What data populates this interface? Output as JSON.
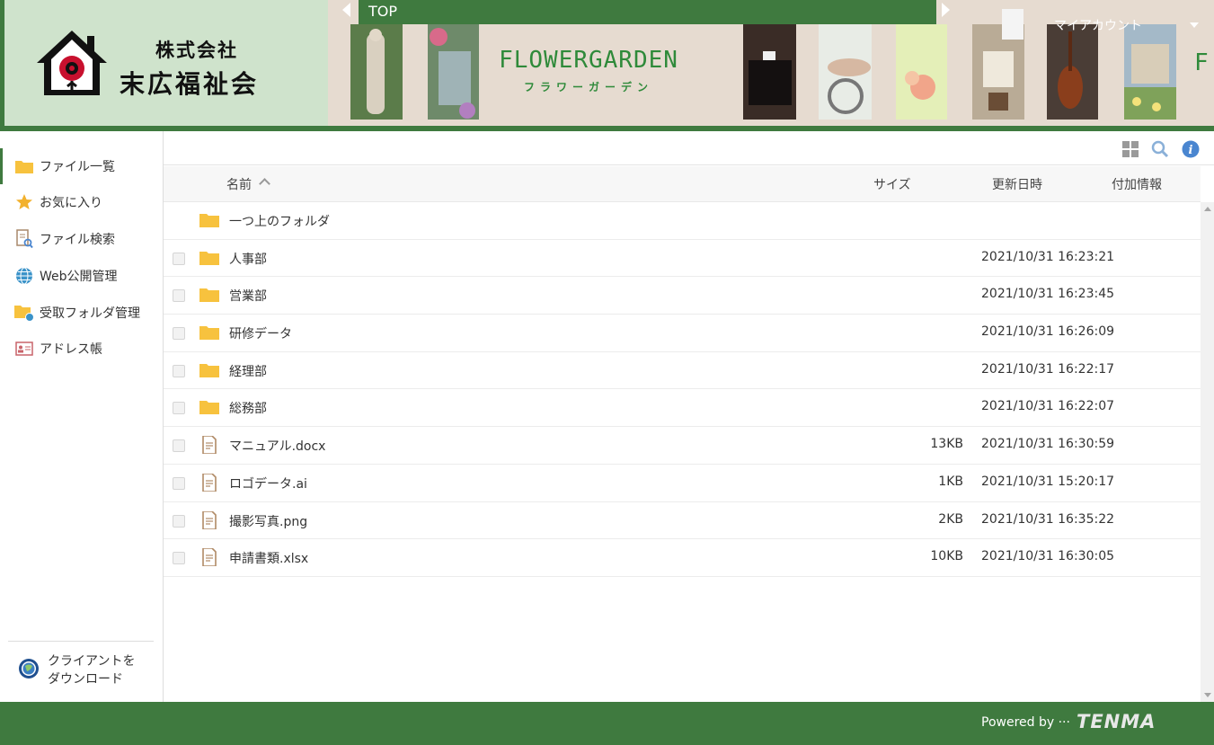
{
  "header": {
    "company_line1": "株式会社",
    "company_line2": "末広福祉会",
    "banner_title": "FLOWERGARDEN",
    "banner_subtitle": "フラワーガーデン",
    "banner_edge_letter": "F",
    "top_label": "TOP",
    "account_label": "マイアカウント"
  },
  "sidebar": {
    "items": [
      {
        "label": "ファイル一覧",
        "icon": "folder-icon"
      },
      {
        "label": "お気に入り",
        "icon": "star-icon"
      },
      {
        "label": "ファイル検索",
        "icon": "file-search-icon"
      },
      {
        "label": "Web公開管理",
        "icon": "globe-icon"
      },
      {
        "label": "受取フォルダ管理",
        "icon": "folder-globe-icon"
      },
      {
        "label": "アドレス帳",
        "icon": "address-card-icon"
      }
    ],
    "download_line1": "クライアントを",
    "download_line2": "ダウンロード"
  },
  "table": {
    "columns": {
      "name": "名前",
      "size": "サイズ",
      "modified": "更新日時",
      "extra": "付加情報"
    },
    "up_folder": "一つ上のフォルダ",
    "rows": [
      {
        "name": "人事部",
        "type": "folder",
        "size": "",
        "date": "2021/10/31 16:23:21"
      },
      {
        "name": "営業部",
        "type": "folder",
        "size": "",
        "date": "2021/10/31 16:23:45"
      },
      {
        "name": "研修データ",
        "type": "folder",
        "size": "",
        "date": "2021/10/31 16:26:09"
      },
      {
        "name": "経理部",
        "type": "folder",
        "size": "",
        "date": "2021/10/31 16:22:17"
      },
      {
        "name": "総務部",
        "type": "folder",
        "size": "",
        "date": "2021/10/31 16:22:07"
      },
      {
        "name": "マニュアル.docx",
        "type": "file",
        "size": "13KB",
        "date": "2021/10/31 16:30:59"
      },
      {
        "name": "ロゴデータ.ai",
        "type": "file",
        "size": "1KB",
        "date": "2021/10/31 15:20:17"
      },
      {
        "name": "撮影写真.png",
        "type": "file",
        "size": "2KB",
        "date": "2021/10/31 16:35:22"
      },
      {
        "name": "申請書類.xlsx",
        "type": "file",
        "size": "10KB",
        "date": "2021/10/31 16:30:05"
      }
    ]
  },
  "footer": {
    "powered_by": "Powered by ···",
    "brand": "TENMA"
  },
  "colors": {
    "brand_green": "#3f7a3f",
    "folder_yellow": "#f7c23e",
    "info_blue": "#4a86d0"
  }
}
